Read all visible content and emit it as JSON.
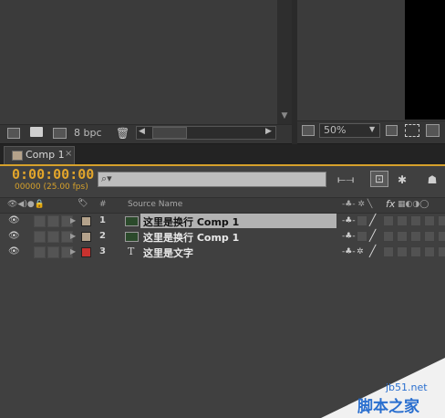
{
  "project_footer": {
    "bit_depth": "8 bpc"
  },
  "viewer_footer": {
    "zoom": "50%"
  },
  "timeline": {
    "tab_label": "Comp 1",
    "tab_close": "×",
    "timecode": "0:00:00:00",
    "fps": "00000 (25.00 fps)",
    "columns": {
      "number": "#",
      "source_name": "Source Name",
      "fx": "fx"
    },
    "layers": [
      {
        "number": "1",
        "name": "这里是换行",
        "suffix": "Comp 1",
        "type": "comp",
        "label_color": "#b4a28b",
        "selected": true
      },
      {
        "number": "2",
        "name": "这里是换行",
        "suffix": "Comp 1",
        "type": "comp",
        "label_color": "#b4a28b",
        "selected": false
      },
      {
        "number": "3",
        "name": "这里是文字",
        "suffix": "",
        "type": "text",
        "label_color": "#c8322f",
        "selected": false
      }
    ]
  },
  "colors": {
    "accent": "#e2a52b",
    "selected_row": "#b2b2b2",
    "watermark": "#2a6fcf"
  },
  "watermark": {
    "site": "jb51.net",
    "name": "脚本之家"
  }
}
